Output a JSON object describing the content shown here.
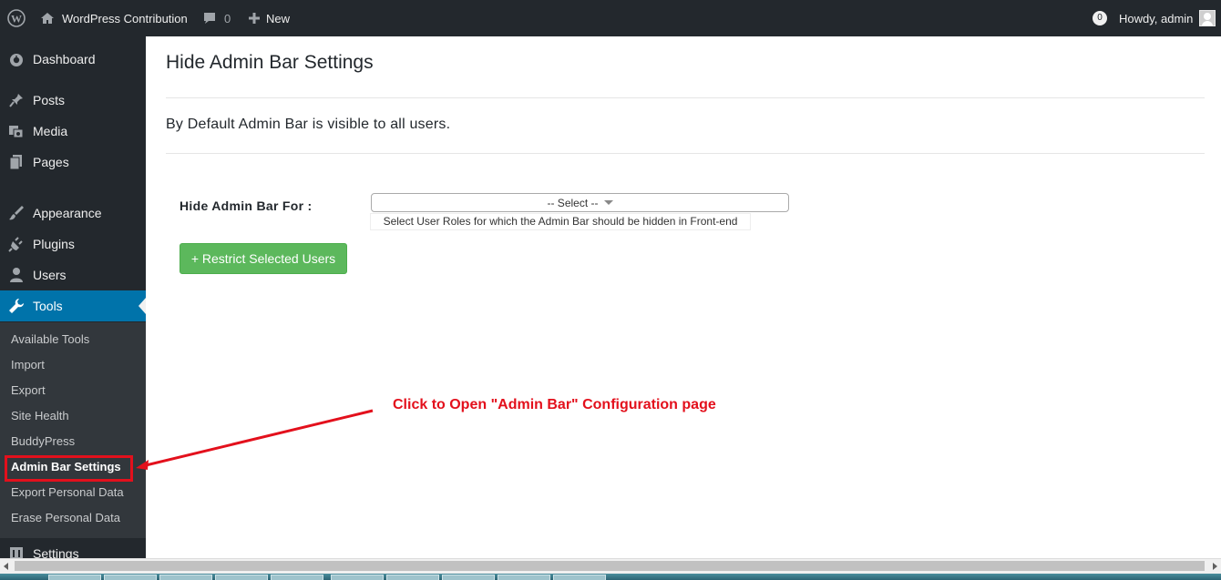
{
  "admin_bar": {
    "site_name": "WordPress Contribution",
    "comments_count": "0",
    "new_label": "New",
    "notifications_count": "0",
    "howdy": "Howdy, admin"
  },
  "sidebar": {
    "menu": [
      {
        "label": "Dashboard",
        "icon": "dashboard-icon"
      },
      {
        "label": "Posts",
        "icon": "pin-icon"
      },
      {
        "label": "Media",
        "icon": "media-icon"
      },
      {
        "label": "Pages",
        "icon": "pages-icon"
      },
      {
        "label": "Appearance",
        "icon": "brush-icon"
      },
      {
        "label": "Plugins",
        "icon": "plugin-icon"
      },
      {
        "label": "Users",
        "icon": "user-icon"
      },
      {
        "label": "Tools",
        "icon": "wrench-icon"
      },
      {
        "label": "Settings",
        "icon": "settings-icon"
      }
    ],
    "tools_submenu": [
      "Available Tools",
      "Import",
      "Export",
      "Site Health",
      "BuddyPress",
      "Admin Bar Settings",
      "Export Personal Data",
      "Erase Personal Data"
    ]
  },
  "main": {
    "title": "Hide Admin Bar Settings",
    "intro": "By Default Admin Bar is visible to all users.",
    "field_label": "Hide Admin Bar For :",
    "select_value": "-- Select --",
    "help_text": "Select User Roles for which the Admin Bar should be hidden in Front-end",
    "button_label": "+ Restrict Selected Users"
  },
  "annotation": {
    "text": "Click to Open \"Admin Bar\" Configuration page",
    "color": "#e3101c"
  },
  "colors": {
    "admin_bar_bg": "#23282d",
    "active_menu": "#0073aa",
    "submenu_bg": "#32373c",
    "button_green": "#5cb85c"
  }
}
